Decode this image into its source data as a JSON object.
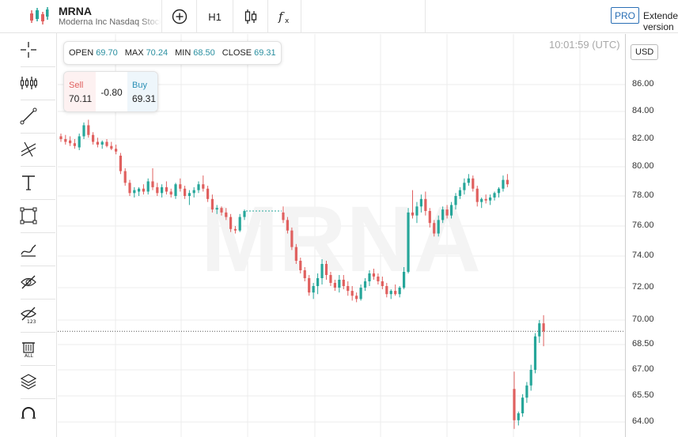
{
  "symbol": {
    "ticker": "MRNA",
    "description": "Moderna Inc Nasdaq Stock"
  },
  "toolbar": {
    "timeframe": "H1",
    "pro_badge": "PRO",
    "extended_label": "Extended version"
  },
  "chart": {
    "timestamp": "10:01:59 (UTC)",
    "currency": "USD",
    "watermark": "MRNA",
    "ohlc": {
      "open_label": "OPEN",
      "open": "69.70",
      "max_label": "MAX",
      "max": "70.24",
      "min_label": "MIN",
      "min": "68.50",
      "close_label": "CLOSE",
      "close": "69.31"
    },
    "trade": {
      "sell_label": "Sell",
      "sell": "70.11",
      "spread": "-0.80",
      "buy_label": "Buy",
      "buy": "69.31"
    },
    "price_ticks": [
      "86.00",
      "84.00",
      "82.00",
      "80.00",
      "78.00",
      "76.00",
      "74.00",
      "72.00",
      "70.00",
      "68.50",
      "67.00",
      "65.50",
      "64.00"
    ]
  },
  "colors": {
    "up": "#26a69a",
    "down": "#e0605f",
    "accent": "#2a6fb5"
  },
  "left_tools": [
    "crosshair-icon",
    "indicators-icon",
    "trend-line-icon",
    "fib-icon",
    "text-icon",
    "rectangle-icon",
    "brush-icon",
    "hide-drawings-icon",
    "hide-labels-icon",
    "remove-all-icon",
    "layers-icon",
    "magnet-icon"
  ],
  "chart_data": {
    "type": "candlestick",
    "y_unit": "USD",
    "ylim": [
      63.5,
      87.5
    ],
    "grid": true,
    "note": "approximate OHLC read from the chart, left to right",
    "candles": [
      [
        82.2,
        82.4,
        81.8,
        82.0
      ],
      [
        82.0,
        82.3,
        81.6,
        81.8
      ],
      [
        81.9,
        82.2,
        81.5,
        81.7
      ],
      [
        81.7,
        82.0,
        81.3,
        81.5
      ],
      [
        81.4,
        82.4,
        81.2,
        82.2
      ],
      [
        82.2,
        83.2,
        82.0,
        83.0
      ],
      [
        83.0,
        83.4,
        82.1,
        82.3
      ],
      [
        82.3,
        82.5,
        81.6,
        81.8
      ],
      [
        81.8,
        82.1,
        81.4,
        81.6
      ],
      [
        81.6,
        81.9,
        81.3,
        81.8
      ],
      [
        81.8,
        82.0,
        81.4,
        81.5
      ],
      [
        81.5,
        81.8,
        81.2,
        81.3
      ],
      [
        81.3,
        81.6,
        80.9,
        81.1
      ],
      [
        80.8,
        81.0,
        79.5,
        79.7
      ],
      [
        79.7,
        79.9,
        78.7,
        78.9
      ],
      [
        78.9,
        79.1,
        78.0,
        78.2
      ],
      [
        78.2,
        78.6,
        77.9,
        78.4
      ],
      [
        78.3,
        78.6,
        78.0,
        78.5
      ],
      [
        78.5,
        78.8,
        78.1,
        78.3
      ],
      [
        78.3,
        79.2,
        78.1,
        79.0
      ],
      [
        79.0,
        79.9,
        78.4,
        78.6
      ],
      [
        78.6,
        78.9,
        78.0,
        78.2
      ],
      [
        78.2,
        78.8,
        77.9,
        78.6
      ],
      [
        78.6,
        79.0,
        78.1,
        78.3
      ],
      [
        78.3,
        78.5,
        77.9,
        78.1
      ],
      [
        78.0,
        78.9,
        77.8,
        78.8
      ],
      [
        78.8,
        79.2,
        78.3,
        78.5
      ],
      [
        78.5,
        78.7,
        77.8,
        78.0
      ],
      [
        78.0,
        78.4,
        77.4,
        78.2
      ],
      [
        78.2,
        78.6,
        77.9,
        78.4
      ],
      [
        78.4,
        79.0,
        78.2,
        78.8
      ],
      [
        78.8,
        79.4,
        78.3,
        78.5
      ],
      [
        78.5,
        78.7,
        77.6,
        77.8
      ],
      [
        77.8,
        78.1,
        76.9,
        77.1
      ],
      [
        77.1,
        77.4,
        76.8,
        77.2
      ],
      [
        77.2,
        77.3,
        76.7,
        76.9
      ],
      [
        76.9,
        77.2,
        76.4,
        76.6
      ],
      [
        76.6,
        76.8,
        75.6,
        75.8
      ],
      [
        75.8,
        76.0,
        75.5,
        75.7
      ],
      [
        75.7,
        76.8,
        75.6,
        76.6
      ],
      [
        76.6,
        77.1,
        76.4,
        77.0
      ],
      [
        76.9,
        77.3,
        76.2,
        76.4
      ],
      [
        76.4,
        76.6,
        75.5,
        75.7
      ],
      [
        75.7,
        75.9,
        74.4,
        74.6
      ],
      [
        74.6,
        74.8,
        73.5,
        73.7
      ],
      [
        73.7,
        73.9,
        72.9,
        73.1
      ],
      [
        73.1,
        73.3,
        72.4,
        72.6
      ],
      [
        72.6,
        72.8,
        71.5,
        71.7
      ],
      [
        71.7,
        72.3,
        71.3,
        72.1
      ],
      [
        72.1,
        72.9,
        71.6,
        72.6
      ],
      [
        72.6,
        73.8,
        72.2,
        73.5
      ],
      [
        73.5,
        73.7,
        72.5,
        72.8
      ],
      [
        72.8,
        73.0,
        72.1,
        72.3
      ],
      [
        72.3,
        72.5,
        71.8,
        72.0
      ],
      [
        72.0,
        72.8,
        71.7,
        72.5
      ],
      [
        72.5,
        72.8,
        71.9,
        72.1
      ],
      [
        72.1,
        72.4,
        71.5,
        71.8
      ],
      [
        71.8,
        72.1,
        71.2,
        71.5
      ],
      [
        71.5,
        71.7,
        71.1,
        71.3
      ],
      [
        71.3,
        72.2,
        71.2,
        72.0
      ],
      [
        72.0,
        72.6,
        71.8,
        72.4
      ],
      [
        72.4,
        73.1,
        72.1,
        72.9
      ],
      [
        72.9,
        73.2,
        72.5,
        72.7
      ],
      [
        72.7,
        72.9,
        72.2,
        72.4
      ],
      [
        72.4,
        72.7,
        71.9,
        72.1
      ],
      [
        72.1,
        72.3,
        71.4,
        71.6
      ],
      [
        71.6,
        71.9,
        71.3,
        71.8
      ],
      [
        71.8,
        72.2,
        71.5,
        71.6
      ],
      [
        71.6,
        72.1,
        71.4,
        72.0
      ],
      [
        72.0,
        73.3,
        71.9,
        73.0
      ],
      [
        73.0,
        77.2,
        72.9,
        76.9
      ],
      [
        76.9,
        78.4,
        76.5,
        76.7
      ],
      [
        76.7,
        77.6,
        76.2,
        77.3
      ],
      [
        77.3,
        78.1,
        76.9,
        77.8
      ],
      [
        77.8,
        78.3,
        76.7,
        77.0
      ],
      [
        77.0,
        77.2,
        75.9,
        76.2
      ],
      [
        76.2,
        76.4,
        75.3,
        75.5
      ],
      [
        75.5,
        76.7,
        75.3,
        76.4
      ],
      [
        76.4,
        77.3,
        76.2,
        77.1
      ],
      [
        77.1,
        77.4,
        76.5,
        76.7
      ],
      [
        76.7,
        77.6,
        76.5,
        77.4
      ],
      [
        77.4,
        78.2,
        77.1,
        78.0
      ],
      [
        78.0,
        78.6,
        77.8,
        78.4
      ],
      [
        78.4,
        79.2,
        78.1,
        78.9
      ],
      [
        78.9,
        79.5,
        78.7,
        79.2
      ],
      [
        79.2,
        79.4,
        78.3,
        78.5
      ],
      [
        78.5,
        78.7,
        77.3,
        77.6
      ],
      [
        77.6,
        77.9,
        77.2,
        77.8
      ],
      [
        77.8,
        78.1,
        77.5,
        77.7
      ],
      [
        77.7,
        78.1,
        77.4,
        77.9
      ],
      [
        77.9,
        78.3,
        77.7,
        78.2
      ],
      [
        78.2,
        78.6,
        77.9,
        78.5
      ],
      [
        78.5,
        79.4,
        78.3,
        79.1
      ],
      [
        79.1,
        79.5,
        78.6,
        78.8
      ],
      [
        65.9,
        66.9,
        63.6,
        64.1
      ],
      [
        64.1,
        64.6,
        63.8,
        64.5
      ],
      [
        64.5,
        65.6,
        64.3,
        65.4
      ],
      [
        65.4,
        66.3,
        65.1,
        66.1
      ],
      [
        66.1,
        67.3,
        65.8,
        67.0
      ],
      [
        67.0,
        69.2,
        66.8,
        69.0
      ],
      [
        69.0,
        70.0,
        68.6,
        69.8
      ],
      [
        69.8,
        70.3,
        68.4,
        69.3
      ]
    ]
  }
}
